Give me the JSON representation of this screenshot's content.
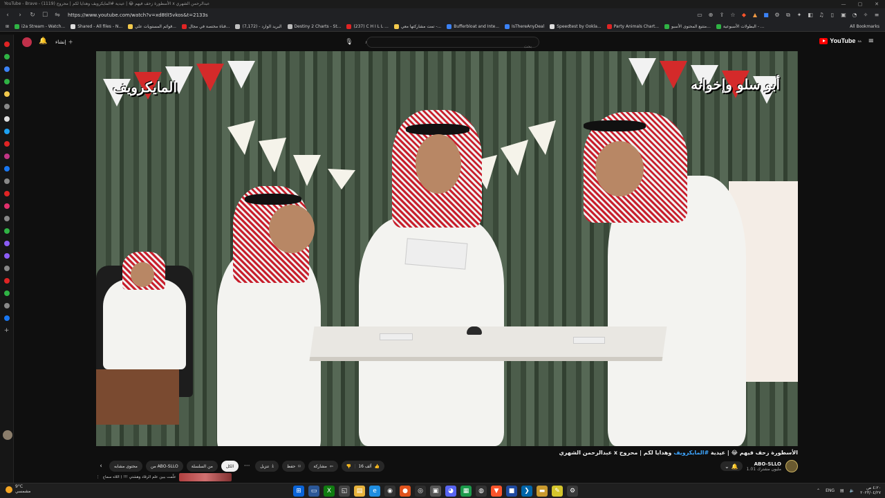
{
  "browser": {
    "window_title": "YouTube - Brave - ‎(1119) الأسطورة زحف فيهم 😂 | عيدية #المايكرويف وهدايا لكم | محروج x عبدالرحمن الشهري",
    "url": "https://www.youtube.com/watch?v=xd8tlI5vkos&t=2133s",
    "bookmarks": [
      {
        "label": "i2a Stream - Watch...",
        "color": "#2fb344"
      },
      {
        "label": "Shared - All files - N...",
        "color": "#dddddd"
      },
      {
        "label": "قوائم المستويات علي...",
        "color": "#f2c94c"
      },
      {
        "label": "قناة مختصة في مجال...",
        "color": "#e02424"
      },
      {
        "label": "البريد الوارد - (7,172)",
        "color": "#c0c0c0"
      },
      {
        "label": "Destiny 2 Charts - St...",
        "color": "#bbbbbb"
      },
      {
        "label": "(237) C H I L L ...",
        "color": "#e02424"
      },
      {
        "label": "تمت مشاركتها معي -...",
        "color": "#f2c94c"
      },
      {
        "label": "Bufferbloat and Inte...",
        "color": "#3b82f6"
      },
      {
        "label": "IsThereAnyDeal",
        "color": "#3b82f6"
      },
      {
        "label": "Speedtest by Ookla...",
        "color": "#dddddd"
      },
      {
        "label": "Party Animals Chart...",
        "color": "#e02424"
      },
      {
        "label": "متتبع المحتوى الأسبو...",
        "color": "#2fb344"
      },
      {
        "label": "البطولات الأسبوعية - ...",
        "color": "#2fb344"
      }
    ],
    "all_bookmarks": "All Bookmarks"
  },
  "youtube": {
    "create_label": "إنشاء",
    "search_placeholder": "بحث",
    "logo_text": "YouTube",
    "logo_region": "SA"
  },
  "video": {
    "watermark_left": "المايكرويف",
    "watermark_right": "أبو سلو وإخوانه",
    "title_prefix": "الأسطورة زحف فيهم 😂 | عيدية ",
    "title_tag": "#المايكرويف",
    "title_suffix": " وهدايا لكم | محروج x عبدالرحمن الشهري"
  },
  "actions": {
    "chips": [
      "الكل",
      "من السلسلة",
      "من ABO-SLLO",
      "محتوى مشابه"
    ],
    "like_count": "16 ألف",
    "share": "مشاركة",
    "save": "حفظ",
    "download": "تنزيل",
    "more": "···"
  },
  "channel": {
    "name": "ABO-SLLO",
    "subscribers": "1.01 مليون مشترك"
  },
  "comment_preview": {
    "text": "علّمت ببين علم الرقاد وهشتي !!! ( اللاه سماح"
  },
  "taskbar": {
    "weather_temp": "9°C",
    "weather_desc": "مشمسي",
    "lang": "ENG",
    "time": "٤:٢٠ ص",
    "date": "٢٠٢٣/٠٤/٢٧"
  },
  "colors": {
    "yt_red": "#ff0000",
    "link_blue": "#3ea6ff"
  }
}
